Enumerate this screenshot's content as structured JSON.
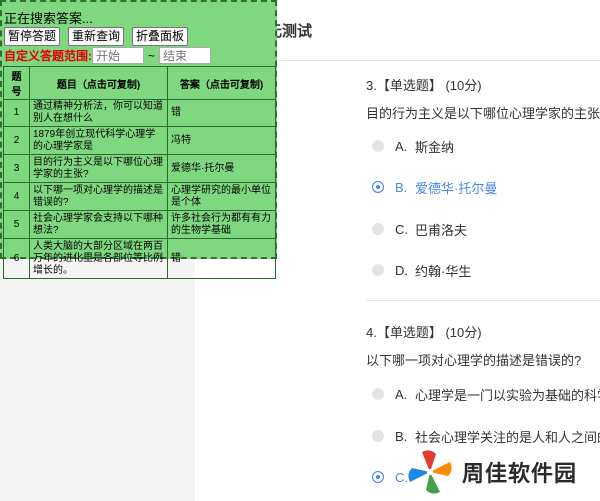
{
  "page": {
    "title": "绪论单元测试"
  },
  "questions": [
    {
      "head": "3.【单选题】 (10分)",
      "text": "目的行为主义是以下哪位心理学家的主张?",
      "options": [
        {
          "letter": "A.",
          "text": "斯金纳",
          "selected": false
        },
        {
          "letter": "B.",
          "text": "爱德华·托尔曼",
          "selected": true
        },
        {
          "letter": "C.",
          "text": "巴甫洛夫",
          "selected": false
        },
        {
          "letter": "D.",
          "text": "约翰·华生",
          "selected": false
        }
      ]
    },
    {
      "head": "4.【单选题】 (10分)",
      "text": "以下哪一项对心理学的描述是错误的?",
      "options": [
        {
          "letter": "A.",
          "text": "心理学是一门以实验为基础的科学",
          "selected": false
        },
        {
          "letter": "B.",
          "text": "社会心理学关注的是人和人之间的关",
          "selected": false
        },
        {
          "letter": "C.",
          "text": "",
          "selected": true
        }
      ]
    }
  ],
  "panel": {
    "status": "正在搜索答案...",
    "buttons": [
      "暂停答题",
      "重新查询",
      "折叠面板"
    ],
    "range_label": "自定义答题范围:",
    "range_start_placeholder": "开始",
    "range_sep": "~",
    "range_end_placeholder": "结束",
    "columns": [
      "题号",
      "题目（点击可复制)",
      "答案（点击可复制)"
    ],
    "rows": [
      {
        "no": "1",
        "question": "通过精神分析法，你可以知道别人在想什么",
        "answer": "错"
      },
      {
        "no": "2",
        "question": "1879年创立现代科学心理学的心理学家是",
        "answer": "冯特"
      },
      {
        "no": "3",
        "question": "目的行为主义是以下哪位心理学家的主张?",
        "answer": "爱德华·托尔曼"
      },
      {
        "no": "4",
        "question": "以下哪一项对心理学的描述是错误的?",
        "answer": "心理学研究的最小单位是个体"
      },
      {
        "no": "5",
        "question": "社会心理学家会支持以下哪种想法?",
        "answer": "许多社会行为都有有力的生物学基础"
      },
      {
        "no": "6",
        "question": "人类大脑的大部分区域在两百万年的进化里是各部位等比例增长的。",
        "answer": "错"
      }
    ]
  },
  "watermark": {
    "text": "周佳软件园"
  },
  "colors": {
    "panel_bg": "#7fd87f",
    "accent_blue": "#4a86e8",
    "range_label": "#e00000"
  }
}
